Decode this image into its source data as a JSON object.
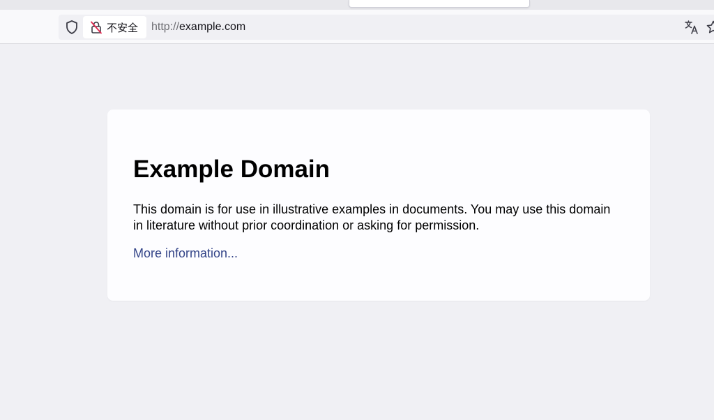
{
  "browser": {
    "security_label": "不安全",
    "url_scheme": "http://",
    "url_host": "example.com",
    "icons": [
      "shield-icon",
      "insecure-lock-icon",
      "translate-icon",
      "bookmark-star-icon"
    ]
  },
  "page": {
    "heading": "Example Domain",
    "body": "This domain is for use in illustrative examples in documents. You may use this domain in literature without prior coordination or asking for permission.",
    "link_text": "More information...",
    "colors": {
      "background": "#f0f0f4",
      "card": "#fdfdff",
      "link": "#334488"
    }
  }
}
